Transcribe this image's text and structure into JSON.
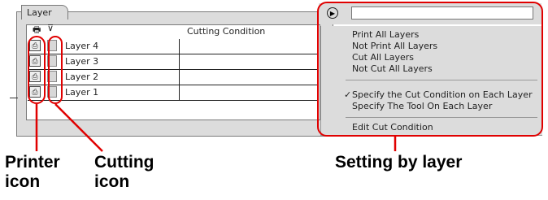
{
  "panel": {
    "tab_label": "Layer",
    "column_header": "Cutting Condition",
    "printer_col_glyph": "🖶",
    "cutter_col_glyph": "⊽",
    "layers": [
      {
        "name": "Layer 4"
      },
      {
        "name": "Layer 3"
      },
      {
        "name": "Layer 2"
      },
      {
        "name": "Layer 1"
      }
    ]
  },
  "menu": {
    "items": [
      "Print All Layers",
      "Not Print All Layers",
      "Cut All Layers",
      "Not Cut All Layers",
      "Specify the Cut Condition on Each Layer",
      "Specify The Tool On Each Layer",
      "Edit Cut Condition"
    ],
    "checked_item": "Specify the Cut Condition on Each Layer"
  },
  "callouts": {
    "printer": "Printer\nicon",
    "cutting": "Cutting\nicon",
    "setting": "Setting by layer"
  },
  "colors": {
    "annotation": "#e00000"
  }
}
